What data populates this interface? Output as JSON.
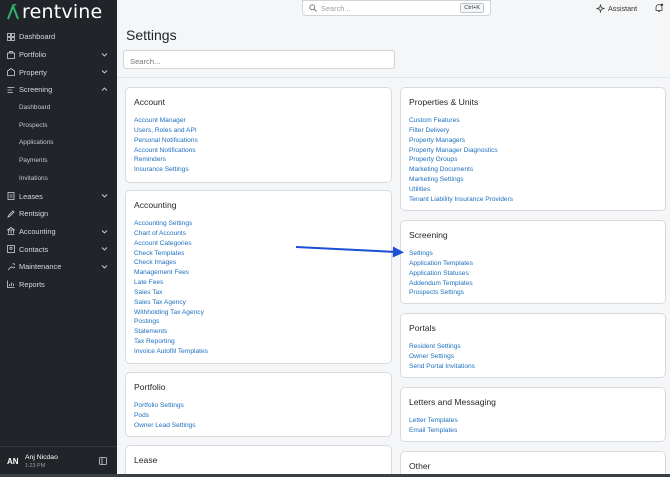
{
  "app": {
    "brand": "rentvine"
  },
  "sidebar": {
    "items": [
      {
        "label": "Dashboard",
        "icon": "dashboard-icon",
        "chevron": false
      },
      {
        "label": "Portfolio",
        "icon": "portfolio-icon",
        "chevron": "down"
      },
      {
        "label": "Property",
        "icon": "property-icon",
        "chevron": "down"
      },
      {
        "label": "Screening",
        "icon": "screening-icon",
        "chevron": "up"
      }
    ],
    "screening_sub": [
      "Dashboard",
      "Prospects",
      "Applications",
      "Payments",
      "Invitations"
    ],
    "items_after": [
      {
        "label": "Leases",
        "icon": "leases-icon",
        "chevron": "down"
      },
      {
        "label": "Rentsign",
        "icon": "rentsign-icon",
        "chevron": false
      },
      {
        "label": "Accounting",
        "icon": "accounting-icon",
        "chevron": "down"
      },
      {
        "label": "Contacts",
        "icon": "contacts-icon",
        "chevron": "down"
      },
      {
        "label": "Maintenance",
        "icon": "maintenance-icon",
        "chevron": "down"
      },
      {
        "label": "Reports",
        "icon": "reports-icon",
        "chevron": false
      }
    ],
    "user": {
      "initials": "AN",
      "name": "Anj Nicdao",
      "time": "1:23 PM"
    }
  },
  "topbar": {
    "search_placeholder": "Search...",
    "shortcut": "Ctrl+K",
    "assistant_label": "Assistant"
  },
  "page": {
    "title": "Settings",
    "search_placeholder": "Search..."
  },
  "cards": {
    "account": {
      "title": "Account",
      "links": [
        "Account Manager",
        "Users, Roles and API",
        "Personal Notifications",
        "Account Notifications",
        "Reminders",
        "Insurance Settings"
      ]
    },
    "accounting": {
      "title": "Accounting",
      "links": [
        "Accounting Settings",
        "Chart of Accounts",
        "Account Categories",
        "Check Templates",
        "Check Images",
        "Management Fees",
        "Late Fees",
        "Sales Tax",
        "Sales Tax Agency",
        "Withholding Tax Agency",
        "Postings",
        "Statements",
        "Tax Reporting",
        "Invoice Autofill Templates"
      ]
    },
    "portfolio": {
      "title": "Portfolio",
      "links": [
        "Portfolio Settings",
        "Pods",
        "Owner Lead Settings"
      ]
    },
    "lease": {
      "title": "Lease",
      "links": []
    },
    "properties_units": {
      "title": "Properties & Units",
      "links": [
        "Custom Features",
        "Filter Delivery",
        "Property Managers",
        "Property Manager Diagnostics",
        "Property Groups",
        "Marketing Documents",
        "Marketing Settings",
        "Utilities",
        "Tenant Liability Insurance Providers"
      ]
    },
    "screening": {
      "title": "Screening",
      "links": [
        "Settings",
        "Application Templates",
        "Application Statuses",
        "Addendum Templates",
        "Prospects Settings"
      ]
    },
    "portals": {
      "title": "Portals",
      "links": [
        "Resident Settings",
        "Owner Settings",
        "Send Portal Invitations"
      ]
    },
    "letters": {
      "title": "Letters and Messaging",
      "links": [
        "Letter Templates",
        "Email Templates"
      ]
    },
    "other": {
      "title": "Other",
      "links": []
    }
  },
  "colors": {
    "sidebar_bg": "#21252a",
    "link": "#1d6fbf",
    "annotation_arrow": "#1a4fd6"
  }
}
